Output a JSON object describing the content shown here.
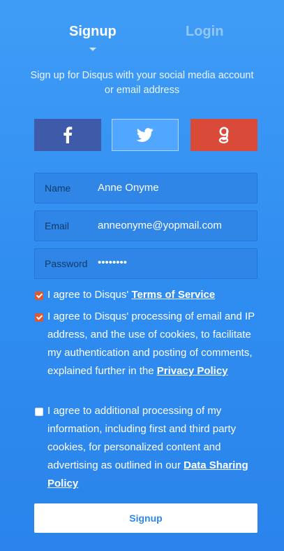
{
  "tabs": {
    "signup": "Signup",
    "login": "Login"
  },
  "intro": "Sign up for Disqus with your social media account or email address",
  "social": {
    "facebook_icon": "facebook-icon",
    "twitter_icon": "twitter-icon",
    "google_icon": "google-icon",
    "colors": {
      "facebook": "#3e5aa8",
      "twitter": "#51a6ff",
      "google": "#d94a38"
    }
  },
  "fields": {
    "name": {
      "label": "Name",
      "value": "Anne Onyme"
    },
    "email": {
      "label": "Email",
      "value": "anneonyme@yopmail.com"
    },
    "password": {
      "label": "Password",
      "value": "••••••••"
    }
  },
  "consents": {
    "tos": {
      "checked": true,
      "text": "I agree to Disqus' ",
      "link": "Terms of Service"
    },
    "privacy": {
      "checked": true,
      "text": "I agree to Disqus' processing of email and IP address, and the use of cookies, to facilitate my authentication and posting of comments, explained further in the ",
      "link": "Privacy Policy"
    },
    "sharing": {
      "checked": false,
      "text": "I agree to additional processing of my information, including first and third party cookies, for personalized content and advertising as outlined in our ",
      "link": "Data Sharing Policy"
    }
  },
  "submit_label": "Signup",
  "colors": {
    "background": "#3a96f3",
    "accent_checkbox": "#e3572f",
    "button_text": "#2e88ea"
  }
}
